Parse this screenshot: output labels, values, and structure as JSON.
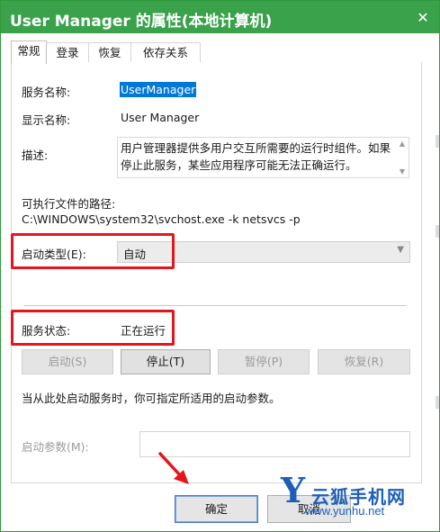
{
  "window": {
    "title": "User Manager 的属性(本地计算机)",
    "close_glyph": "✕"
  },
  "tabs": [
    {
      "label": "常规",
      "active": true
    },
    {
      "label": "登录",
      "active": false
    },
    {
      "label": "恢复",
      "active": false
    },
    {
      "label": "依存关系",
      "active": false
    }
  ],
  "general": {
    "service_name_label": "服务名称:",
    "service_name_value": "UserManager",
    "display_name_label": "显示名称:",
    "display_name_value": "User Manager",
    "description_label": "描述:",
    "description_value": "用户管理器提供多用户交互所需要的运行时组件。如果停止此服务，某些应用程序可能无法正确运行。",
    "path_label": "可执行文件的路径:",
    "path_value": "C:\\WINDOWS\\system32\\svchost.exe -k netsvcs -p",
    "startup_type_label": "启动类型(E):",
    "startup_type_value": "自动",
    "service_status_label": "服务状态:",
    "service_status_value": "正在运行"
  },
  "service_buttons": {
    "start": "启动(S)",
    "stop": "停止(T)",
    "pause": "暂停(P)",
    "resume": "恢复(R)"
  },
  "start_params": {
    "hint": "当从此处启动服务时，你可指定所适用的启动参数。",
    "label": "启动参数(M):",
    "value": ""
  },
  "footer": {
    "ok": "确定",
    "cancel": "取消"
  },
  "watermark": {
    "logo_letter": "Y",
    "site_name": "云狐手机网",
    "url": "www.yunhu.net"
  },
  "annotations": {
    "highlight_color": "#e5151c",
    "arrow_color": "#e5151c"
  },
  "colors": {
    "titlebar": "#3aa24b",
    "selection": "#0078d7",
    "watermark": "#1d5fb8"
  }
}
